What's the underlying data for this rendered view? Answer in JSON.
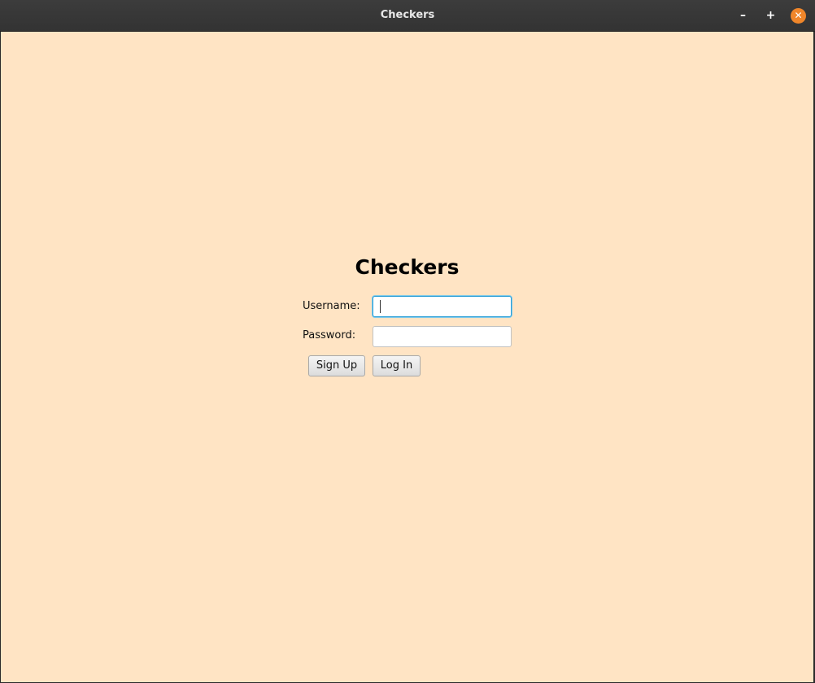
{
  "window": {
    "title": "Checkers",
    "controls": {
      "minimize": "–",
      "maximize": "+",
      "close": "✕"
    }
  },
  "form": {
    "heading": "Checkers",
    "username_label": "Username:",
    "username_value": "",
    "password_label": "Password:",
    "password_value": "",
    "signup_label": "Sign Up",
    "login_label": "Log In"
  },
  "colors": {
    "background": "#ffe4c4",
    "close_button": "#f0862a",
    "focus_ring": "#2a9fd6"
  }
}
